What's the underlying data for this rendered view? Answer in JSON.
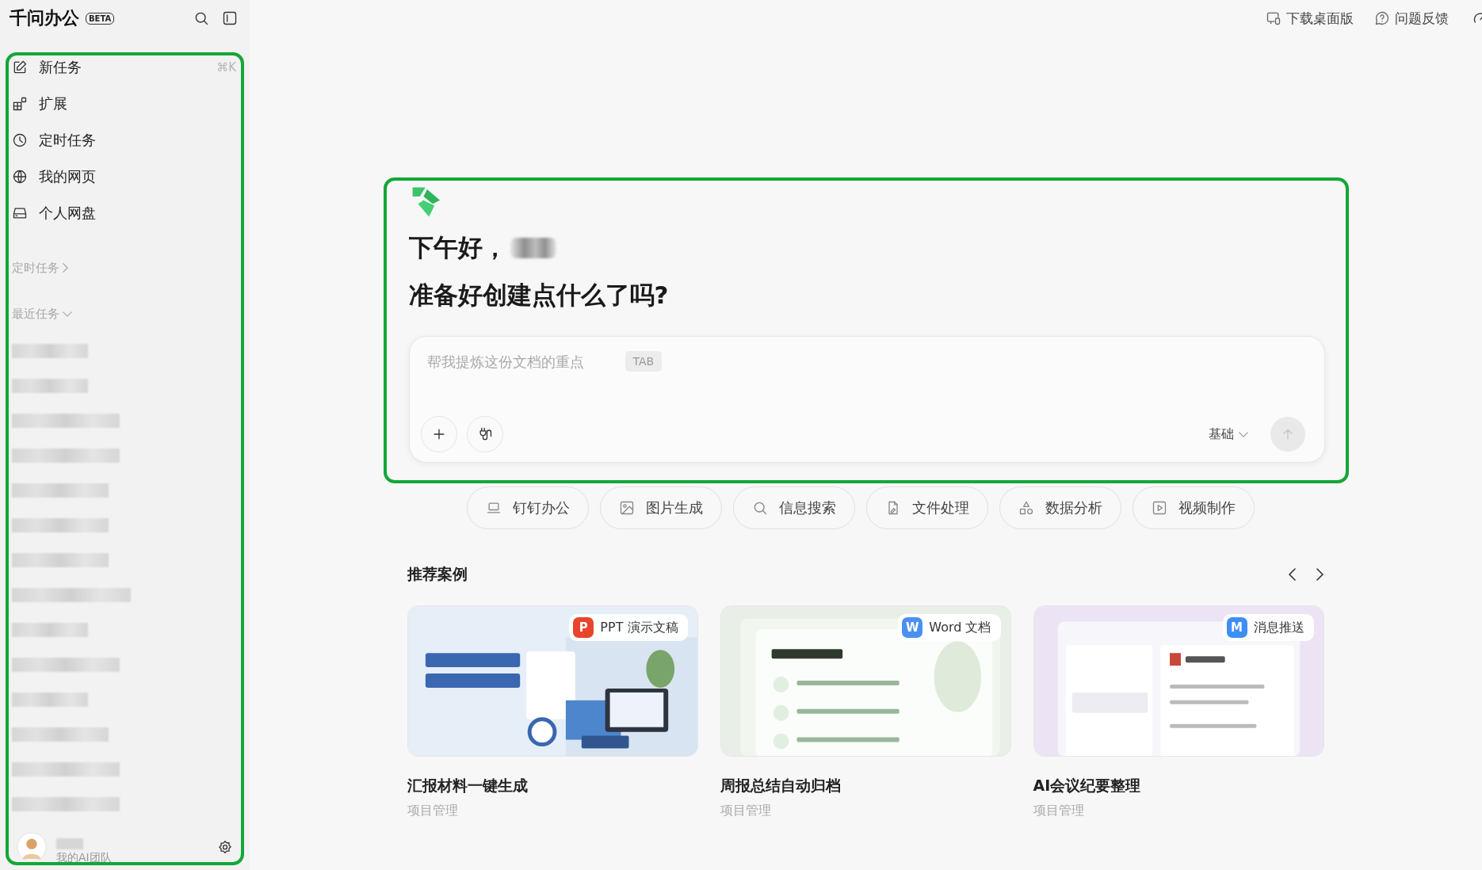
{
  "app": {
    "title": "千问办公",
    "badge": "BETA"
  },
  "sidebar": {
    "nav": [
      {
        "label": "新任务",
        "shortcut": "⌘K"
      },
      {
        "label": "扩展"
      },
      {
        "label": "定时任务"
      },
      {
        "label": "我的网页"
      },
      {
        "label": "个人网盘"
      }
    ],
    "sections": [
      {
        "label": "定时任务",
        "expanded": false
      },
      {
        "label": "最近任务",
        "expanded": true
      }
    ],
    "recent_tasks": [
      {
        "kind": "redacted"
      },
      {
        "kind": "redacted"
      },
      {
        "kind": "redacted"
      },
      {
        "kind": "redacted"
      },
      {
        "kind": "redacted"
      },
      {
        "kind": "redacted"
      },
      {
        "kind": "redacted"
      },
      {
        "kind": "redacted"
      },
      {
        "kind": "redacted"
      },
      {
        "kind": "redacted"
      },
      {
        "kind": "redacted"
      },
      {
        "kind": "redacted"
      },
      {
        "kind": "redacted"
      },
      {
        "kind": "redacted"
      }
    ],
    "footer": {
      "subtitle": "我的AI团队"
    }
  },
  "header": {
    "actions": [
      {
        "label": "下载桌面版"
      },
      {
        "label": "问题反馈"
      }
    ]
  },
  "hero": {
    "greeting": "下午好，",
    "prompt": "准备好创建点什么了吗?",
    "input": {
      "placeholder": "帮我提炼这份文档的重点",
      "hint": "TAB",
      "mode": "基础"
    }
  },
  "quick_actions": [
    {
      "label": "钉钉办公"
    },
    {
      "label": "图片生成"
    },
    {
      "label": "信息搜索"
    },
    {
      "label": "文件处理"
    },
    {
      "label": "数据分析"
    },
    {
      "label": "视频制作"
    }
  ],
  "recommended": {
    "title": "推荐案例",
    "cases": [
      {
        "title": "汇报材料一键生成",
        "category": "项目管理",
        "badge": "PPT 演示文稿",
        "badge_letter": "P",
        "color": "#e8452c"
      },
      {
        "title": "周报总结自动归档",
        "category": "项目管理",
        "badge": "Word 文档",
        "badge_letter": "W",
        "color": "#4a90f0"
      },
      {
        "title": "AI会议纪要整理",
        "category": "项目管理",
        "badge": "消息推送",
        "badge_letter": "M",
        "color": "#3d8ef5"
      }
    ]
  }
}
